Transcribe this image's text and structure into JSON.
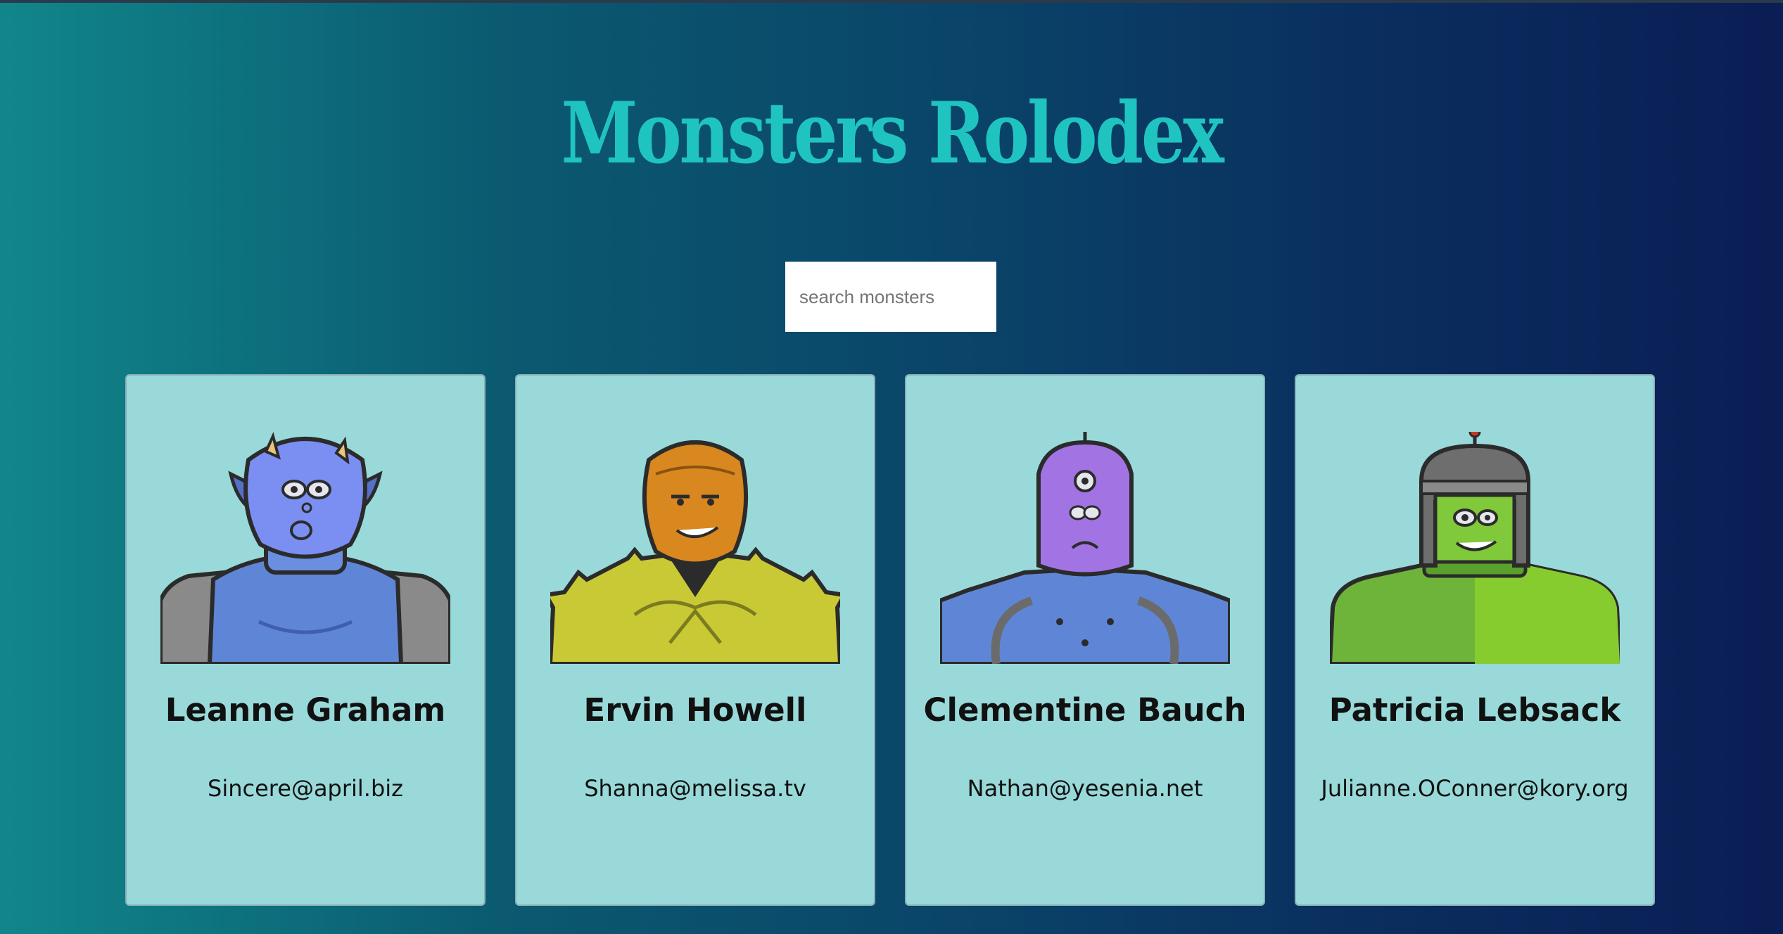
{
  "header": {
    "title": "Monsters Rolodex"
  },
  "search": {
    "placeholder": "search monsters",
    "value": ""
  },
  "cards": [
    {
      "name": "Leanne Graham",
      "email": "Sincere@april.biz",
      "avatar": "blue-horned-monster"
    },
    {
      "name": "Ervin Howell",
      "email": "Shanna@melissa.tv",
      "avatar": "orange-spiky-monster"
    },
    {
      "name": "Clementine Bauch",
      "email": "Nathan@yesenia.net",
      "avatar": "purple-cyclops-robot-monster"
    },
    {
      "name": "Patricia Lebsack",
      "email": "Julianne.OConner@kory.org",
      "avatar": "green-helmet-monster"
    }
  ],
  "colors": {
    "title": "#1fc4c0",
    "card_background": "#99d9d9",
    "gradient_start": "#10868a",
    "gradient_end": "#0a1d54"
  }
}
